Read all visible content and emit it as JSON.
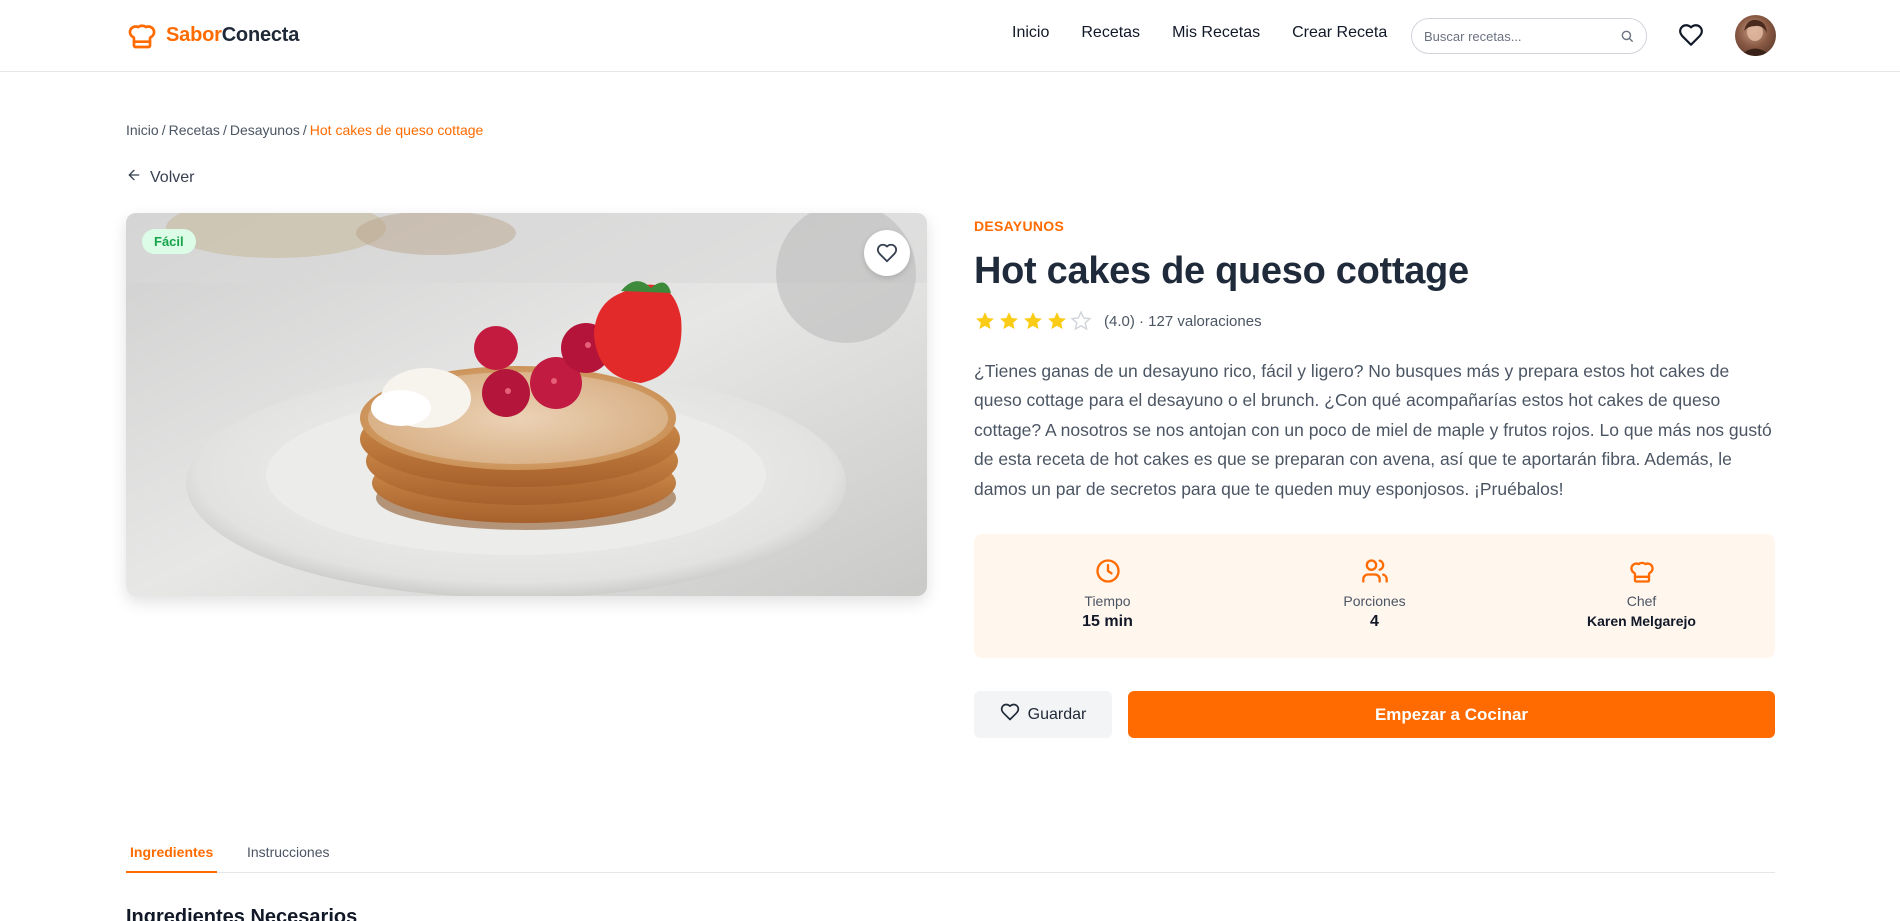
{
  "brand": {
    "part1": "Sabor",
    "part2": "Conecta",
    "accent": "#ff6b00"
  },
  "nav": {
    "items": [
      "Inicio",
      "Recetas",
      "Mis Recetas",
      "Crear Receta"
    ]
  },
  "search": {
    "placeholder": "Buscar recetas..."
  },
  "breadcrumb": {
    "items": [
      "Inicio",
      "Recetas",
      "Desayunos"
    ],
    "current": "Hot cakes de queso cottage"
  },
  "back": {
    "label": "Volver"
  },
  "hero": {
    "difficulty": "Fácil"
  },
  "recipe": {
    "category": "DESAYUNOS",
    "title": "Hot cakes de queso cottage",
    "rating": 4.0,
    "rating_text": "(4.0) · 127 valoraciones",
    "description": "¿Tienes ganas de un desayuno rico, fácil y ligero? No busques más y prepara estos hot cakes de queso cottage para el desayuno o el brunch. ¿Con qué acompañarías estos hot cakes de queso cottage? A nosotros se nos antojan con un poco de miel de maple y frutos rojos. Lo que más nos gustó de esta receta de hot cakes es que se preparan con avena, así que te aportarán fibra. Además, le damos un par de secretos para que te queden muy esponjosos. ¡Pruébalos!"
  },
  "stats": {
    "time": {
      "label": "Tiempo",
      "value": "15 min",
      "icon": "clock-icon"
    },
    "servings": {
      "label": "Porciones",
      "value": "4",
      "icon": "users-icon"
    },
    "chef": {
      "label": "Chef",
      "value": "Karen Melgarejo",
      "icon": "chef-hat-icon"
    }
  },
  "actions": {
    "save": "Guardar",
    "start": "Empezar a Cocinar"
  },
  "tabs": {
    "ingredients": "Ingredientes",
    "instructions": "Instrucciones"
  },
  "section": {
    "title": "Ingredientes Necesarios"
  }
}
